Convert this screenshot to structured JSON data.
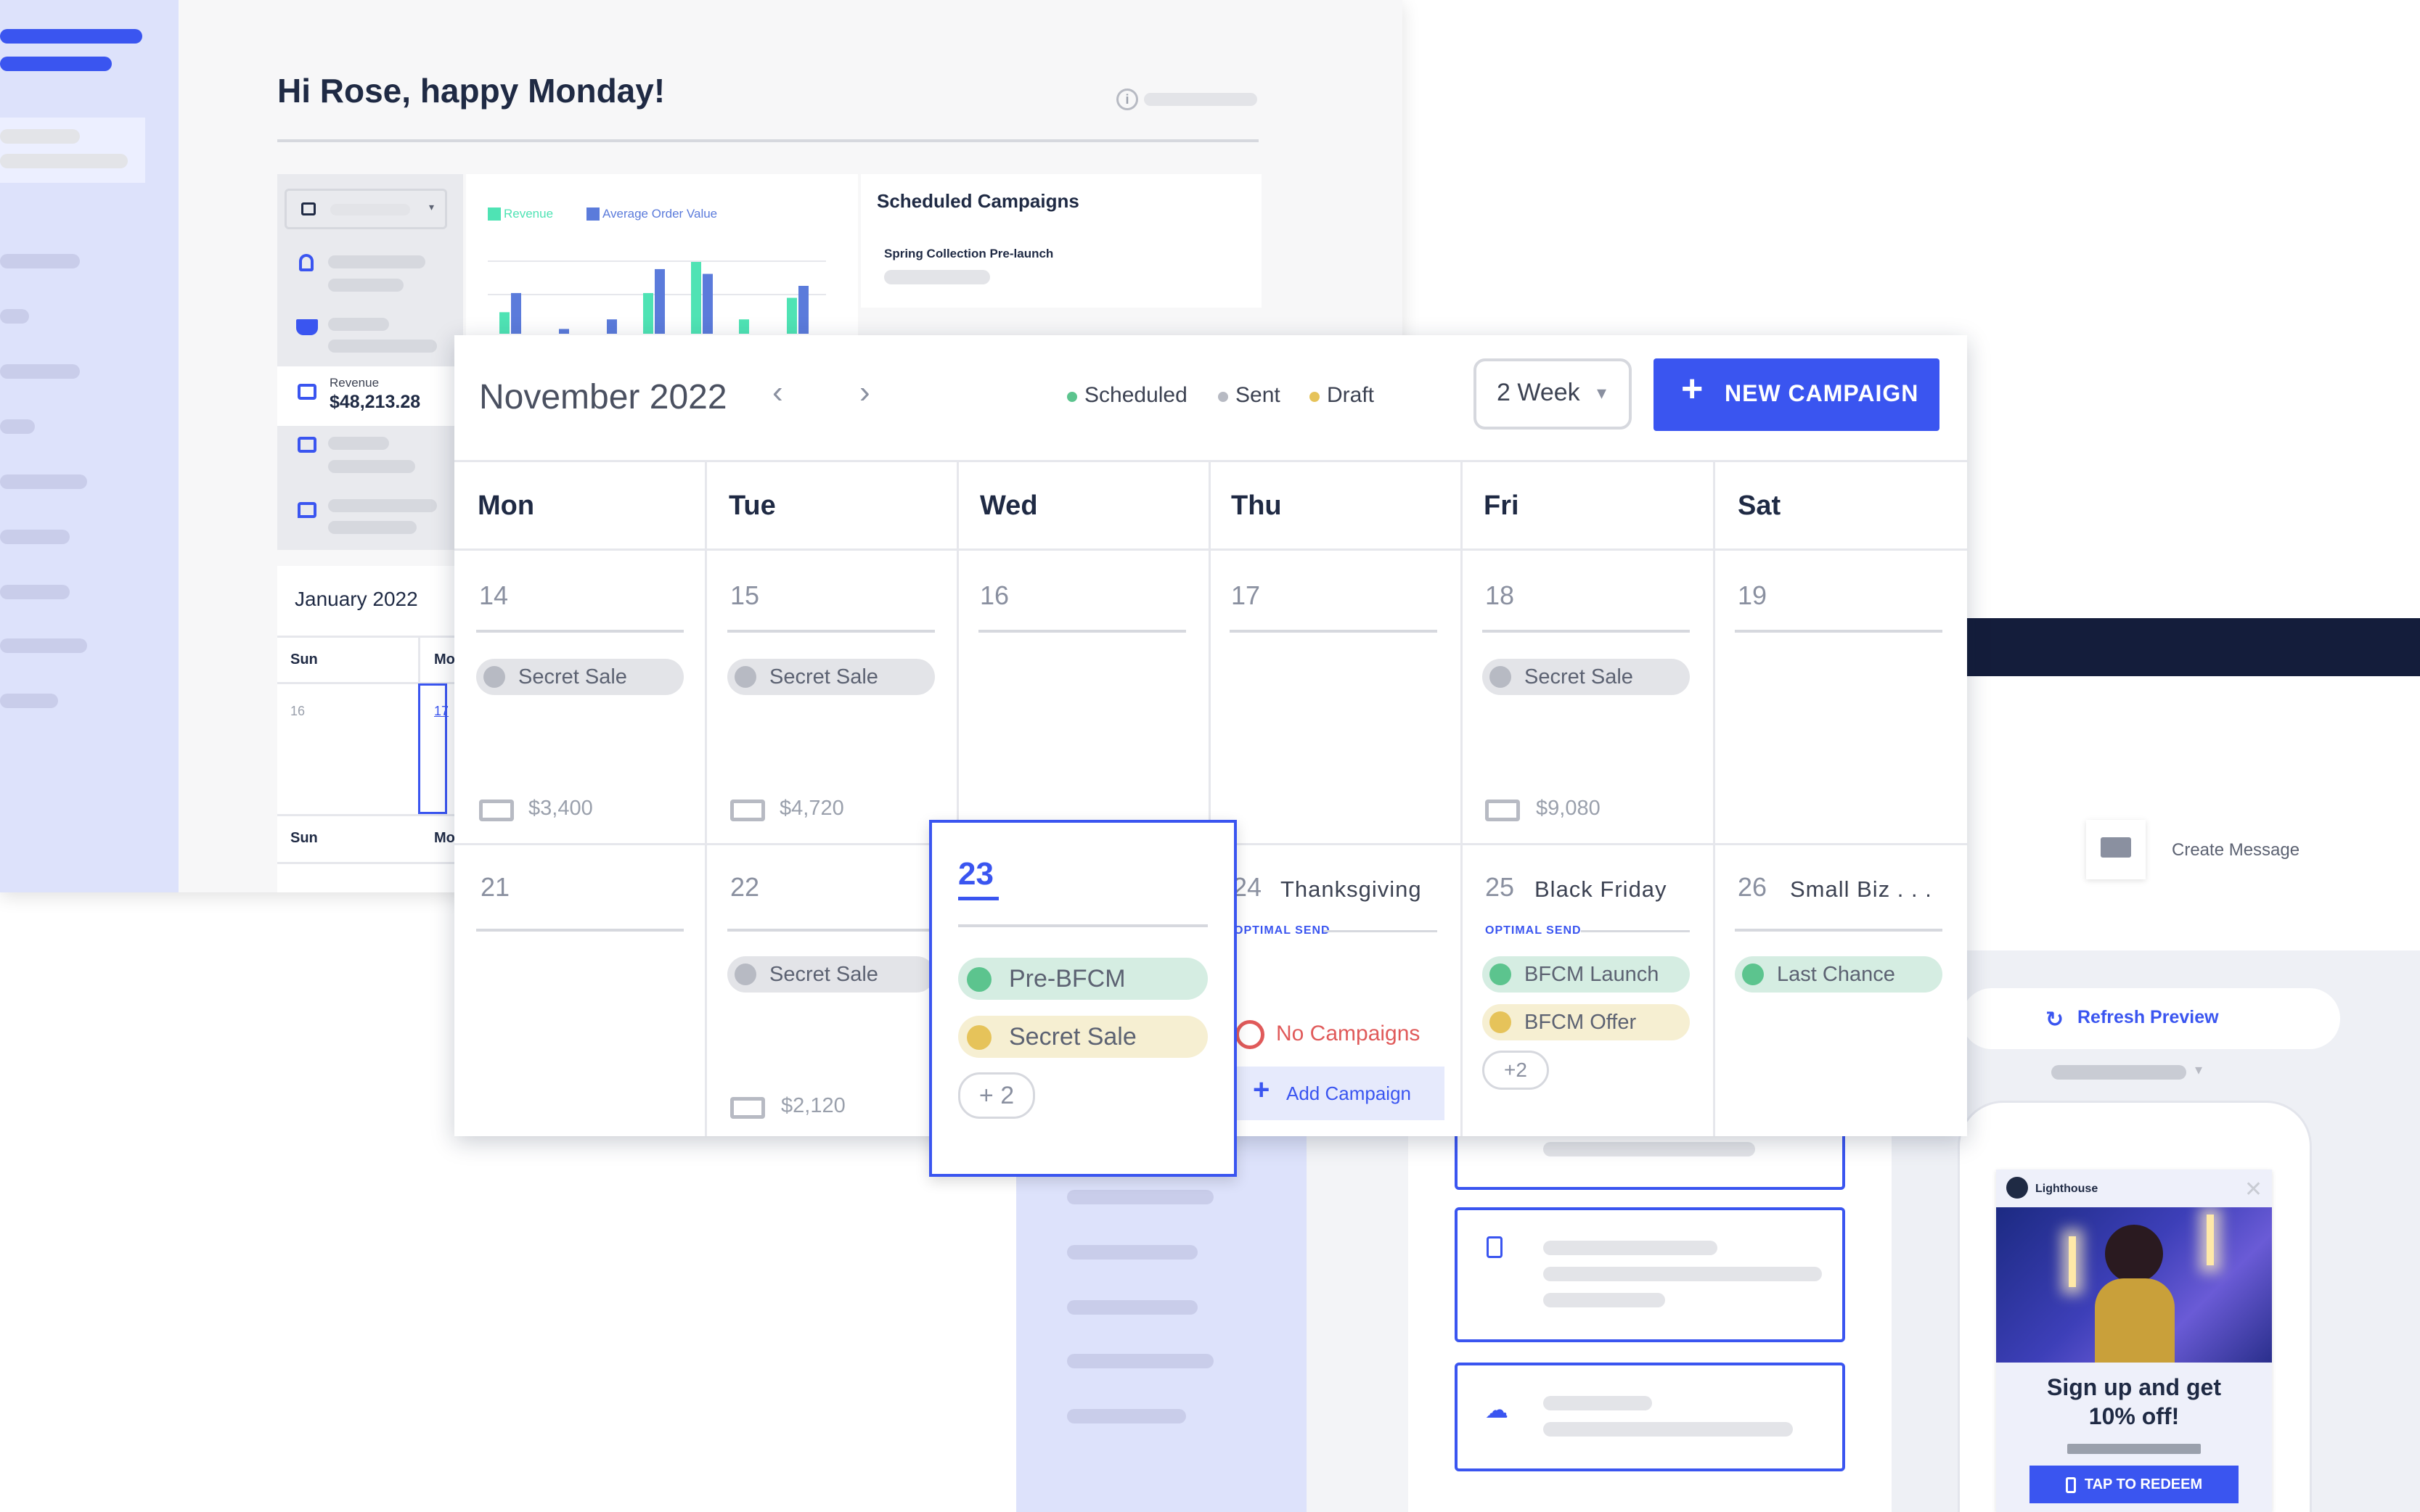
{
  "dashboard": {
    "greeting": "Hi Rose, happy Monday!",
    "info_icon": "info-icon",
    "revenue_caption": "Revenue",
    "revenue_value": "$48,213.28",
    "chart_legend": {
      "revenue": "Revenue",
      "aov": "Average Order Value"
    },
    "colors": {
      "revenue": "#4fe3b4",
      "aov": "#5b7bdb",
      "brand": "#3a55f0"
    },
    "scheduled_title": "Scheduled Campaigns",
    "scheduled_item": "Spring Collection Pre-launch",
    "mini_calendar": {
      "title": "January 2022",
      "head1": "Sun",
      "head2": "Mo",
      "num1": "16",
      "num2": "17",
      "head3": "Sun",
      "head4": "Mo"
    }
  },
  "chart_data": {
    "type": "bar",
    "series": [
      {
        "name": "Revenue",
        "values": [
          18,
          0,
          0,
          34,
          60,
          12,
          30
        ]
      },
      {
        "name": "Average Order Value",
        "values": [
          34,
          4,
          12,
          54,
          50,
          0,
          40
        ]
      }
    ],
    "title": "",
    "xlabel": "",
    "ylabel": "",
    "legend": "top-left"
  },
  "calendar": {
    "month": "November 2022",
    "prev_icon": "chevron-left-icon",
    "next_icon": "chevron-right-icon",
    "legend": [
      {
        "label": "Scheduled",
        "color": "#5cc48e"
      },
      {
        "label": "Sent",
        "color": "#b7bac3"
      },
      {
        "label": "Draft",
        "color": "#e6c35a"
      }
    ],
    "view_select": "2 Week",
    "new_campaign": "NEW CAMPAIGN",
    "days": [
      "Mon",
      "Tue",
      "Wed",
      "Thu",
      "Fri",
      "Sat"
    ],
    "week1": [
      {
        "num": "14",
        "pill": "Secret Sale",
        "amount": "$3,400"
      },
      {
        "num": "15",
        "pill": "Secret Sale",
        "amount": "$4,720"
      },
      {
        "num": "16"
      },
      {
        "num": "17"
      },
      {
        "num": "18",
        "pill": "Secret Sale",
        "amount": "$9,080"
      },
      {
        "num": "19"
      }
    ],
    "week2": [
      {
        "num": "21"
      },
      {
        "num": "22",
        "pill": "Secret Sale",
        "amount": "$2,120"
      },
      {
        "num": "23",
        "pills": [
          "Pre-BFCM",
          "Secret Sale"
        ],
        "more": "+ 2"
      },
      {
        "num": "24",
        "title": "Thanksgiving",
        "optimal": "OPTIMAL SEND",
        "empty": "No Campaigns",
        "add": "Add Campaign"
      },
      {
        "num": "25",
        "title": "Black Friday",
        "optimal": "OPTIMAL SEND",
        "pills": [
          "BFCM Launch",
          "BFCM Offer"
        ],
        "more": "+2"
      },
      {
        "num": "26",
        "title": "Small Biz . . .",
        "pills": [
          "Last Chance"
        ]
      }
    ]
  },
  "preview": {
    "create_message": "Create Message",
    "refresh": "Refresh Preview",
    "brand": "Lighthouse",
    "headline_1": "Sign up and get",
    "headline_2": "10% off!",
    "redeem": "TAP TO REDEEM"
  }
}
